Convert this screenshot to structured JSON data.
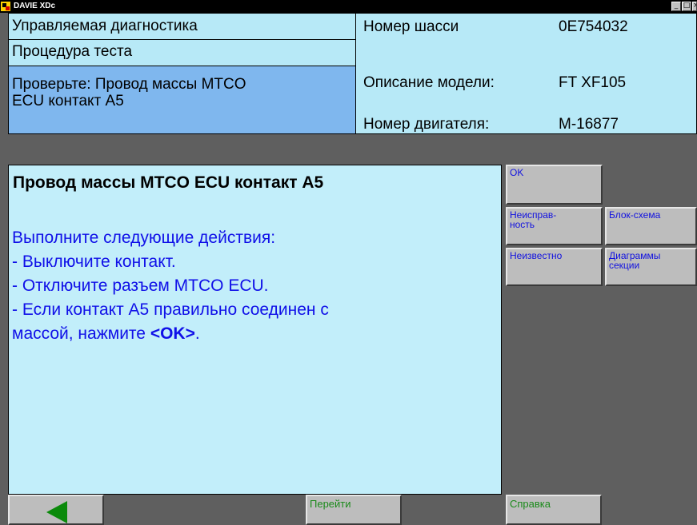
{
  "window": {
    "title": "DAVIE XDc",
    "controls": [
      "minimize-icon",
      "maximize-icon",
      "close-icon"
    ],
    "control_glyphs": {
      "minimize": "_",
      "maximize": "□",
      "close": "×"
    }
  },
  "header": {
    "left": {
      "item1": "Управляемая диагностика",
      "item2": "Процедура теста",
      "item3_line1": "Проверьте: Провод массы MTCO",
      "item3_line2": "ECU контакт A5"
    },
    "right": {
      "chassis_label": "Номер шасси",
      "chassis_value": "0E754032",
      "model_label": "Описание модели:",
      "model_value": "FT XF105",
      "engine_label": "Номер двигателя:",
      "engine_value": "M-16877"
    }
  },
  "content": {
    "title": "Провод массы MTCO ECU контакт A5",
    "line1": "Выполните следующие действия:",
    "line2": "- Выключите контакт.",
    "line3": "- Отключите разъем MTCO ECU.",
    "line4": "- Если контакт A5 правильно соединен с",
    "line5_pre": "массой, нажмите ",
    "line5_bold": "<OK>",
    "line5_post": "."
  },
  "side_buttons": {
    "ok": "OK",
    "fault_line1": "Неисправ-",
    "fault_line2": "ность",
    "block": "Блок-схема",
    "unknown": "Неизвестно",
    "diagrams_line1": "Диаграммы",
    "diagrams_line2": "секции"
  },
  "bottom_buttons": {
    "back_icon": "back-arrow-icon",
    "goto": "Перейти",
    "help": "Справка"
  },
  "colors": {
    "panel": "#b7e9f7",
    "selected": "#7fb7ee",
    "content_bg": "#c2eefa",
    "content_text": "#1010e8",
    "button_text": "#1010e0",
    "bottom_button_text": "#1a8a1a",
    "background": "#5f5f5f"
  }
}
